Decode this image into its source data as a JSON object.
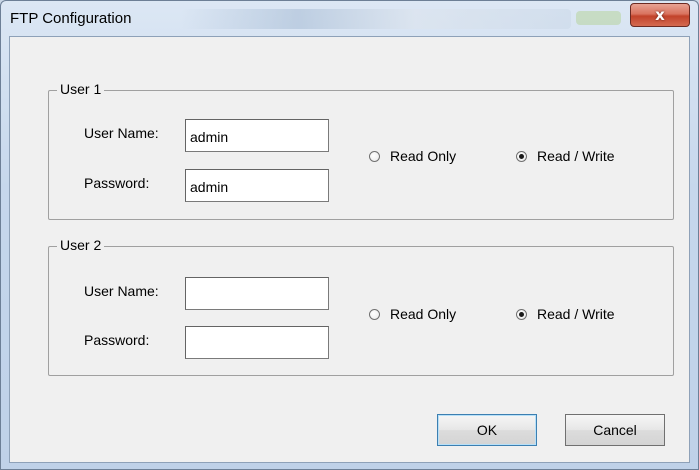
{
  "window": {
    "title": "FTP Configuration",
    "close_glyph": "x"
  },
  "user1": {
    "legend": "User 1",
    "username_label": "User Name:",
    "username_value": "admin",
    "password_label": "Password:",
    "password_value": "admin",
    "read_only_label": "Read Only",
    "read_write_label": "Read / Write",
    "selected": "Read / Write"
  },
  "user2": {
    "legend": "User 2",
    "username_label": "User Name:",
    "username_value": "",
    "password_label": "Password:",
    "password_value": "",
    "read_only_label": "Read Only",
    "read_write_label": "Read / Write",
    "selected": "Read / Write"
  },
  "buttons": {
    "ok_label": "OK",
    "cancel_label": "Cancel"
  },
  "colors": {
    "close_button": "#c2432b",
    "dialog_background": "#f0f0f0",
    "default_button_border": "#3c7fb1"
  }
}
